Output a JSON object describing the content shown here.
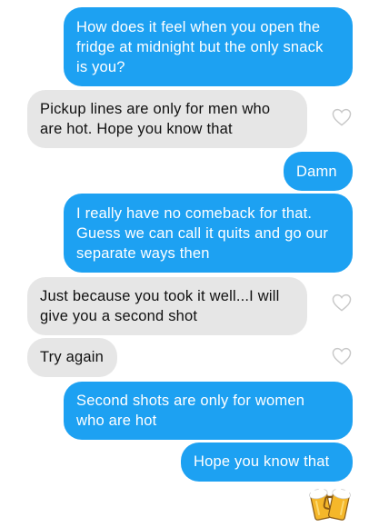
{
  "conversation": {
    "messages": [
      {
        "direction": "sent",
        "text": "How does it feel when you open the\nfridge at midnight but the only snack\nis you?"
      },
      {
        "direction": "received",
        "text": "Pickup lines are only for men who\nare hot. Hope you know that",
        "reaction": "heart-outline-icon"
      },
      {
        "direction": "sent",
        "text": "Damn"
      },
      {
        "direction": "sent",
        "text": "I really have no comeback for that.\nGuess we can call it quits and go our\nseparate ways then"
      },
      {
        "direction": "received",
        "text": "Just because you took it well...I will\ngive you a second shot",
        "reaction": "heart-outline-icon"
      },
      {
        "direction": "received",
        "text": "Try again",
        "reaction": "heart-outline-icon"
      },
      {
        "direction": "sent",
        "text": "Second shots are only for women\nwho are hot"
      },
      {
        "direction": "sent",
        "text": "Hope you know that"
      }
    ],
    "trailing_emoji": "clinking-beer-mugs"
  },
  "colors": {
    "sent_bubble": "#1da1f2",
    "sent_text": "#ffffff",
    "received_bubble": "#e6e6e6",
    "received_text": "#111111",
    "heart_outline": "#c8c8c8"
  }
}
